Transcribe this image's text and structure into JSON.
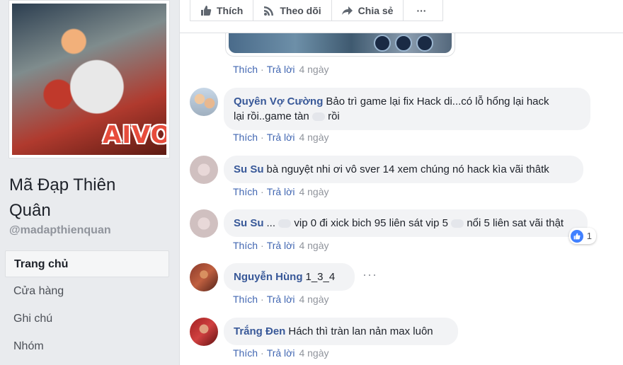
{
  "page": {
    "name": "Mã Đạp Thiên Quân",
    "handle": "@madapthienquan",
    "cover_logo": "AIVO"
  },
  "nav": [
    {
      "label": "Trang chủ",
      "active": true
    },
    {
      "label": "Cửa hàng"
    },
    {
      "label": "Ghi chú"
    },
    {
      "label": "Nhóm"
    }
  ],
  "actions": {
    "like": "Thích",
    "follow": "Theo dõi",
    "share": "Chia sẻ",
    "more": "···"
  },
  "meta_labels": {
    "like": "Thích",
    "reply": "Trả lời",
    "dot": "·"
  },
  "first_meta_time": "4 ngày",
  "comments": [
    {
      "author": "Quyên Vợ Cường",
      "text_1": "Bảo trì game lại fix Hack di...có lỗ hổng lại hack",
      "text_2": "lại rồi..game tàn",
      "text_3": "rồi",
      "time": "4 ngày"
    },
    {
      "author": "Su Su",
      "text": "bà nguyệt nhi ơi vô sver 14 xem chúng nó hack kìa vãi thâtk",
      "time": "4 ngày"
    },
    {
      "author": "Su Su",
      "text_1": "...",
      "text_2": "vip 0 đi xick bich 95 liên sát vip 5",
      "text_3": "nổi 5 liên sat vãi thật",
      "time": "4 ngày",
      "reactions": "1"
    },
    {
      "author": "Nguyễn Hùng",
      "text": "1_3_4",
      "time": "4 ngày",
      "more": "···"
    },
    {
      "author": "Trắng Đen",
      "text": "Hách thì tràn lan nản max luôn",
      "time": "4 ngày"
    }
  ],
  "colors": {
    "link": "#385898",
    "meta": "#4267b2",
    "bubble": "#f2f3f5",
    "bg": "#e9ebee"
  }
}
